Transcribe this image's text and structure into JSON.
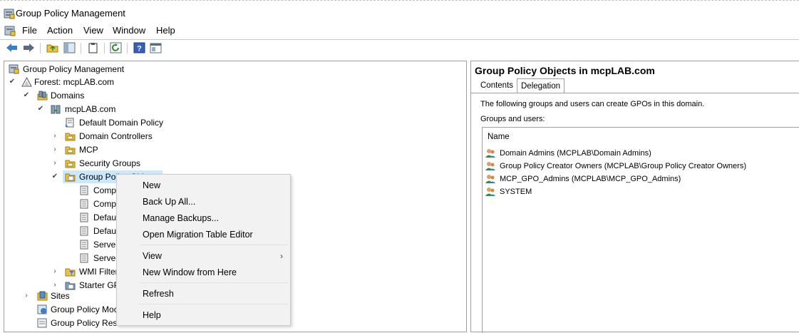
{
  "window": {
    "title": "Group Policy Management"
  },
  "menubar": {
    "items": [
      "File",
      "Action",
      "View",
      "Window",
      "Help"
    ]
  },
  "toolbar": {
    "buttons": [
      "back-icon",
      "forward-icon",
      "up-folder-icon",
      "show-hide-tree-icon",
      "properties-icon",
      "refresh-icon",
      "help-icon",
      "new-window-icon"
    ]
  },
  "tree": {
    "root": "Group Policy Management",
    "forest": "Forest: mcpLAB.com",
    "domains": "Domains",
    "domain": "mcpLAB.com",
    "default_domain_policy": "Default Domain Policy",
    "domain_controllers": "Domain Controllers",
    "mcp": "MCP",
    "security_groups": "Security Groups",
    "gpo": "Group Policy Objects",
    "gpo_children": [
      "Comp",
      "Comp",
      "Defaul",
      "Defaul",
      "Server",
      "Server"
    ],
    "wmi_filters": "WMI Filter",
    "starter_gpos": "Starter GP",
    "sites": "Sites",
    "modeling": "Group Policy Moc",
    "results": "Group Policy Results"
  },
  "right_pane": {
    "title": "Group Policy Objects in mcpLAB.com",
    "tabs": [
      "Contents",
      "Delegation"
    ],
    "active_tab": "Delegation",
    "description": "The following groups and users can create GPOs in this domain.",
    "groups_label": "Groups and users:",
    "column_header": "Name",
    "entries": [
      "Domain Admins (MCPLAB\\Domain Admins)",
      "Group Policy Creator Owners (MCPLAB\\Group Policy Creator Owners)",
      "MCP_GPO_Admins (MCPLAB\\MCP_GPO_Admins)",
      "SYSTEM"
    ]
  },
  "context_menu": {
    "items": [
      "New",
      "Back Up All...",
      "Manage Backups...",
      "Open Migration Table Editor",
      "View",
      "New Window from Here",
      "Refresh",
      "Help"
    ],
    "submenu_arrow": "›"
  },
  "colors": {
    "selection": "#cce8ff",
    "border": "#a0a0a0",
    "menu_bg": "#f2f2f2"
  }
}
